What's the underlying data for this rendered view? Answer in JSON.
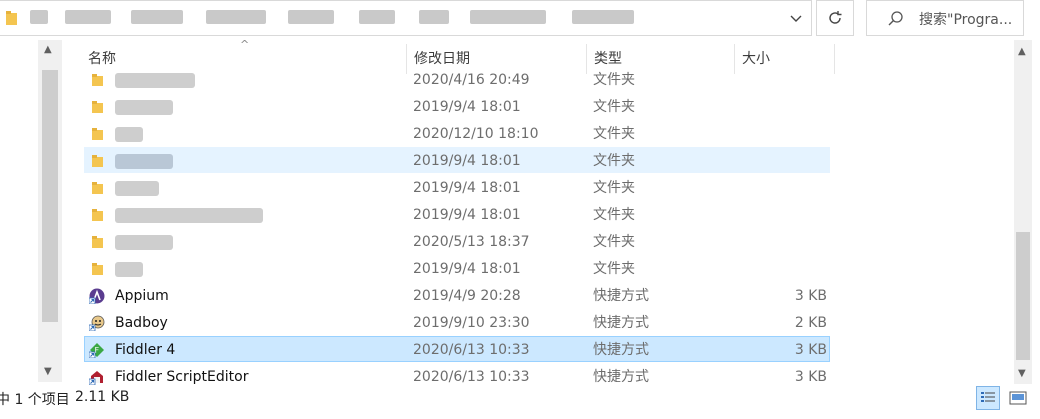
{
  "address_bar": {
    "path_visible": "...",
    "chevron": "chevron-down-icon"
  },
  "search": {
    "placeholder": "搜索\"Progra..."
  },
  "columns": [
    {
      "label": "名称"
    },
    {
      "label": "修改日期"
    },
    {
      "label": "类型"
    },
    {
      "label": "大小"
    }
  ],
  "rows": [
    {
      "name": "",
      "date": "2020/4/16 20:49",
      "type": "文件夹",
      "size": "",
      "icon": "folder-icon",
      "state": "normal"
    },
    {
      "name": "",
      "date": "2019/9/4 18:01",
      "type": "文件夹",
      "size": "",
      "icon": "folder-icon",
      "state": "normal"
    },
    {
      "name": "",
      "date": "2020/12/10 18:10",
      "type": "文件夹",
      "size": "",
      "icon": "folder-icon",
      "state": "normal"
    },
    {
      "name": "",
      "date": "2019/9/4 18:01",
      "type": "文件夹",
      "size": "",
      "icon": "folder-icon",
      "state": "hover"
    },
    {
      "name": "",
      "date": "2019/9/4 18:01",
      "type": "文件夹",
      "size": "",
      "icon": "folder-icon",
      "state": "normal"
    },
    {
      "name": "",
      "date": "2019/9/4 18:01",
      "type": "文件夹",
      "size": "",
      "icon": "folder-icon",
      "state": "normal"
    },
    {
      "name": "",
      "date": "2020/5/13 18:37",
      "type": "文件夹",
      "size": "",
      "icon": "folder-icon",
      "state": "normal"
    },
    {
      "name": "",
      "date": "2019/9/4 18:01",
      "type": "文件夹",
      "size": "",
      "icon": "folder-icon",
      "state": "normal"
    },
    {
      "name": "Appium",
      "date": "2019/4/9 20:28",
      "type": "快捷方式",
      "size": "3 KB",
      "icon": "appium-shortcut-icon",
      "state": "normal"
    },
    {
      "name": "Badboy",
      "date": "2019/9/10 23:30",
      "type": "快捷方式",
      "size": "2 KB",
      "icon": "badboy-shortcut-icon",
      "state": "normal"
    },
    {
      "name": "Fiddler 4",
      "date": "2020/6/13 10:33",
      "type": "快捷方式",
      "size": "3 KB",
      "icon": "fiddler-shortcut-icon",
      "state": "selected"
    },
    {
      "name": "Fiddler ScriptEditor",
      "date": "2020/6/13 10:33",
      "type": "快捷方式",
      "size": "3 KB",
      "icon": "scripteditor-shortcut-icon",
      "state": "normal"
    }
  ],
  "status": {
    "selection": "中 1 个项目",
    "size": "2.11 KB"
  },
  "colors": {
    "hover_row": "#e5f3ff",
    "selected_row": "#cce8ff",
    "selected_border": "#99d1ff",
    "folder": "#f4c550"
  }
}
